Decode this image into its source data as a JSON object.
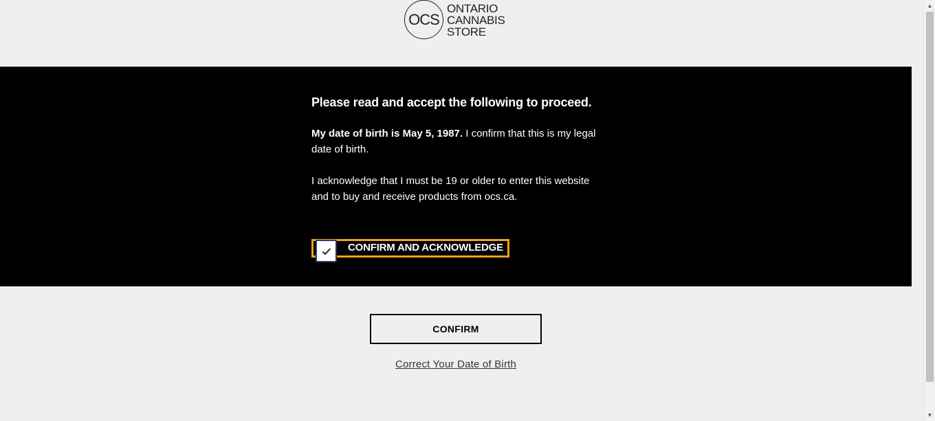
{
  "header": {
    "logo_mark": "OCS",
    "logo_line1": "ONTARIO",
    "logo_line2": "CANNABIS",
    "logo_line3": "STORE"
  },
  "gate": {
    "heading": "Please read and accept the following to proceed.",
    "dob_bold": "My date of birth is May 5, 1987.",
    "dob_rest": " I confirm that this is my legal date of birth.",
    "acknowledge_text": "I acknowledge that I must be 19 or older to enter this website and to buy and receive products from ocs.ca.",
    "checkbox_label": "CONFIRM AND ACKNOWLEDGE",
    "checkbox_checked": true
  },
  "actions": {
    "confirm_label": "CONFIRM",
    "correct_dob_link": "Correct Your Date of Birth"
  },
  "colors": {
    "band_bg": "#000000",
    "page_bg": "#efefef",
    "focus_outline": "#f0a21a"
  },
  "icons": {
    "checkmark": "check-icon",
    "scroll_up": "scroll-up-arrow-icon",
    "scroll_down": "scroll-down-arrow-icon"
  }
}
